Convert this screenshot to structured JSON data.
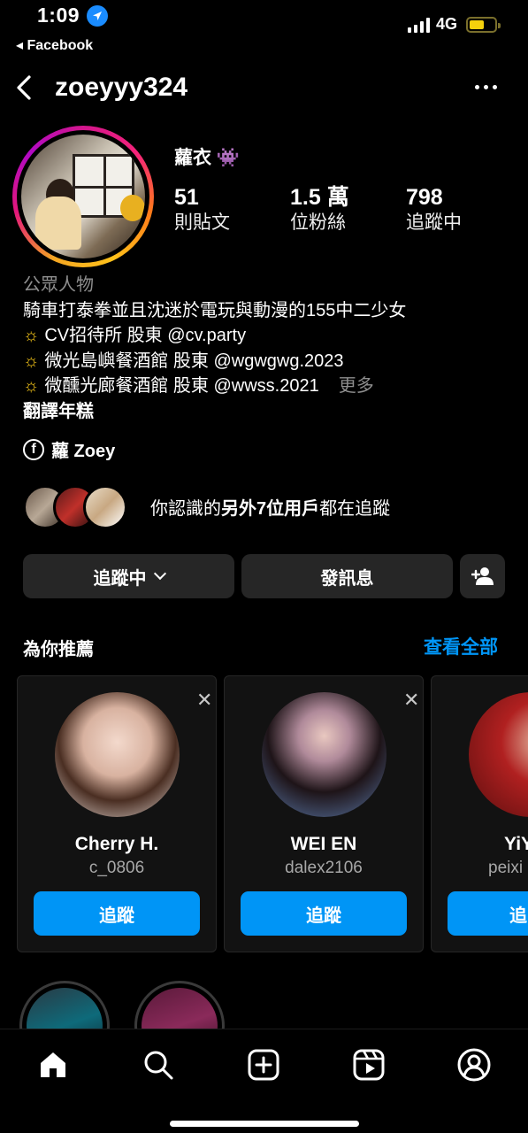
{
  "status_bar": {
    "time": "1:09",
    "back_app": "◂ Facebook",
    "network": "4G"
  },
  "header": {
    "username": "zoeyyy324"
  },
  "profile": {
    "display_name": "蘿衣 👾",
    "stats": [
      {
        "value": "51",
        "label": "則貼文"
      },
      {
        "value": "1.5 萬",
        "label": "位粉絲"
      },
      {
        "value": "798",
        "label": "追蹤中"
      }
    ],
    "bio": {
      "category": "公眾人物",
      "line1": "騎車打泰拳並且沈迷於電玩與動漫的155中二少女",
      "line2": "CV招待所  股東 @cv.party",
      "line3": "微光島嶼餐酒館  股東 @wgwgwg.2023",
      "line4": "微醺光廊餐酒館  股東 @wwss.2021",
      "more": "更多",
      "line5": "翻譯年糕",
      "sun_icon": "☼"
    },
    "facebook_link": "蘿 Zoey",
    "mutual": {
      "prefix": "你認識的",
      "highlight": "另外7位用戶",
      "suffix": "都在追蹤"
    }
  },
  "actions": {
    "following": "追蹤中",
    "message": "發訊息"
  },
  "suggestions": {
    "title": "為你推薦",
    "see_all": "查看全部",
    "cards": [
      {
        "name": "Cherry H.",
        "username": "c_0806",
        "follow": "追蹤"
      },
      {
        "name": "WEI EN",
        "username": "dalex2106",
        "follow": "追蹤"
      },
      {
        "name": "YiY",
        "username": "peixi",
        "follow": "追"
      }
    ]
  },
  "colors": {
    "accent": "#0095f6",
    "button_bg": "#262626",
    "background": "#000000"
  }
}
